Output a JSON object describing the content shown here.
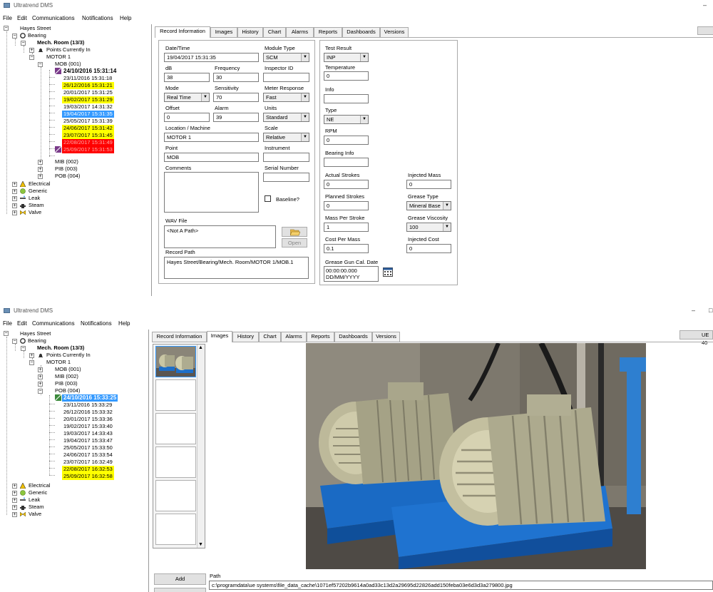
{
  "w1": {
    "title": "Ultratrend DMS",
    "menu": [
      "File",
      "Edit",
      "Communications",
      "Notifications",
      "Help"
    ],
    "tree": {
      "hayes": "Hayes Street",
      "bearing": "Bearing",
      "mech": "Mech. Room (13/3)",
      "points": "Points Currently In",
      "motor": "MOTOR 1",
      "mob": "MOB (001)",
      "r0": "24/10/2016 15:31:14",
      "r1": "23/11/2016 15:31:18",
      "r2": "26/12/2016 15:31:21",
      "r3": "20/01/2017 15:31:25",
      "r4": "19/02/2017 15:31:29",
      "r5": "19/03/2017 14:31:32",
      "r6": "19/04/2017 15:31:35",
      "r7": "25/05/2017 15:31:39",
      "r8": "24/06/2017 15:31:42",
      "r9": "23/07/2017 15:31:45",
      "r10": "22/08/2017 15:31:49",
      "r11": "25/09/2017 15:31:53",
      "mib": "MIB (002)",
      "pib": "PIB (003)",
      "pob": "POB (004)",
      "electrical": "Electrical",
      "generic": "Generic",
      "leak": "Leak",
      "steam": "Steam",
      "valve": "Valve"
    },
    "tabs": [
      "Record Information",
      "Images",
      "History",
      "Chart",
      "Alarms",
      "Reports",
      "Dashboards",
      "Versions"
    ],
    "form": {
      "date_lbl": "Date/Time",
      "date_val": "19/04/2017  15:31:35",
      "modtype_lbl": "Module Type",
      "modtype_val": "SCM",
      "db_lbl": "dB",
      "db_val": "38",
      "freq_lbl": "Frequency",
      "freq_val": "30",
      "inspector_lbl": "Inspector ID",
      "mode_lbl": "Mode",
      "mode_val": "Real Time",
      "sens_lbl": "Sensitivity",
      "sens_val": "70",
      "meter_lbl": "Meter Response",
      "meter_val": "Fast",
      "offset_lbl": "Offset",
      "offset_val": "0",
      "alarm_lbl": "Alarm",
      "alarm_val": "39",
      "units_lbl": "Units",
      "units_val": "Standard",
      "loc_lbl": "Location / Machine",
      "loc_val": "MOTOR 1",
      "scale_lbl": "Scale",
      "scale_val": "Relative",
      "point_lbl": "Point",
      "point_val": "MOB",
      "instr_lbl": "Instrument",
      "comments_lbl": "Comments",
      "serial_lbl": "Serial Number",
      "baseline_lbl": "Baseline?",
      "wav_lbl": "WAV File",
      "wav_val": "<Not A Path>",
      "open_btn": "Open",
      "recpath_lbl": "Record Path",
      "recpath_val": "Hayes Street/Bearing/Mech. Room/MOTOR 1/MOB.1"
    },
    "right": {
      "test_lbl": "Test Result",
      "test_val": "INP",
      "temp_lbl": "Temperature",
      "temp_val": "0",
      "info_lbl": "Info",
      "type_lbl": "Type",
      "type_val": "NE",
      "rpm_lbl": "RPM",
      "rpm_val": "0",
      "binfo_lbl": "Bearing Info",
      "act_lbl": "Actual Strokes",
      "act_val": "0",
      "inj_lbl": "Injected Mass",
      "inj_val": "0",
      "plan_lbl": "Planned Strokes",
      "plan_val": "0",
      "gtype_lbl": "Grease Type",
      "gtype_val": "Mineral Base",
      "mps_lbl": "Mass Per Stroke",
      "mps_val": "1",
      "gvisc_lbl": "Grease Viscosity",
      "gvisc_val": "100",
      "cpm_lbl": "Cost Per Mass",
      "cpm_val": "0.1",
      "injc_lbl": "Injected Cost",
      "injc_val": "0",
      "ggun_lbl": "Grease Gun Cal. Date",
      "ggun_val1": "00:00:00.000",
      "ggun_val2": "DD/MM/YYYY"
    }
  },
  "w2": {
    "title": "Ultratrend DMS",
    "menu": [
      "File",
      "Edit",
      "Communications",
      "Notifications",
      "Help"
    ],
    "tree": {
      "hayes": "Hayes Street",
      "bearing": "Bearing",
      "mech": "Mech. Room (13/3)",
      "points": "Points Currently In",
      "motor": "MOTOR 1",
      "mob": "MOB (001)",
      "mib": "MIB (002)",
      "pib": "PIB (003)",
      "pob": "POB (004)",
      "r0": "24/10/2016 15:33:25",
      "r1": "23/11/2016 15:33:29",
      "r2": "26/12/2016 15:33:32",
      "r3": "20/01/2017 15:33:36",
      "r4": "19/02/2017 15:33:40",
      "r5": "19/03/2017 14:33:43",
      "r6": "19/04/2017 15:33:47",
      "r7": "25/05/2017 15:33:50",
      "r8": "24/06/2017 15:33:54",
      "r9": "23/07/2017 16:32:49",
      "r10": "22/08/2017 16:32:53",
      "r11": "25/09/2017 16:32:58",
      "electrical": "Electrical",
      "generic": "Generic",
      "leak": "Leak",
      "steam": "Steam",
      "valve": "Valve"
    },
    "tabs": [
      "Record Information",
      "Images",
      "History",
      "Chart",
      "Alarms",
      "Reports",
      "Dashboards",
      "Versions"
    ],
    "side_btn": "UE 40",
    "add_btn": "Add",
    "path_lbl": "Path",
    "path_val": "c:\\programdata\\ue systems\\file_data_cache\\1071ef57202b9614a0ad33c13d2a29695d22826add150feba03e6d3d3a279800.jpg"
  },
  "colors": {
    "highlight_yellow": "#ffff00",
    "highlight_red": "#ff0000",
    "selection_blue": "#3399ff"
  }
}
